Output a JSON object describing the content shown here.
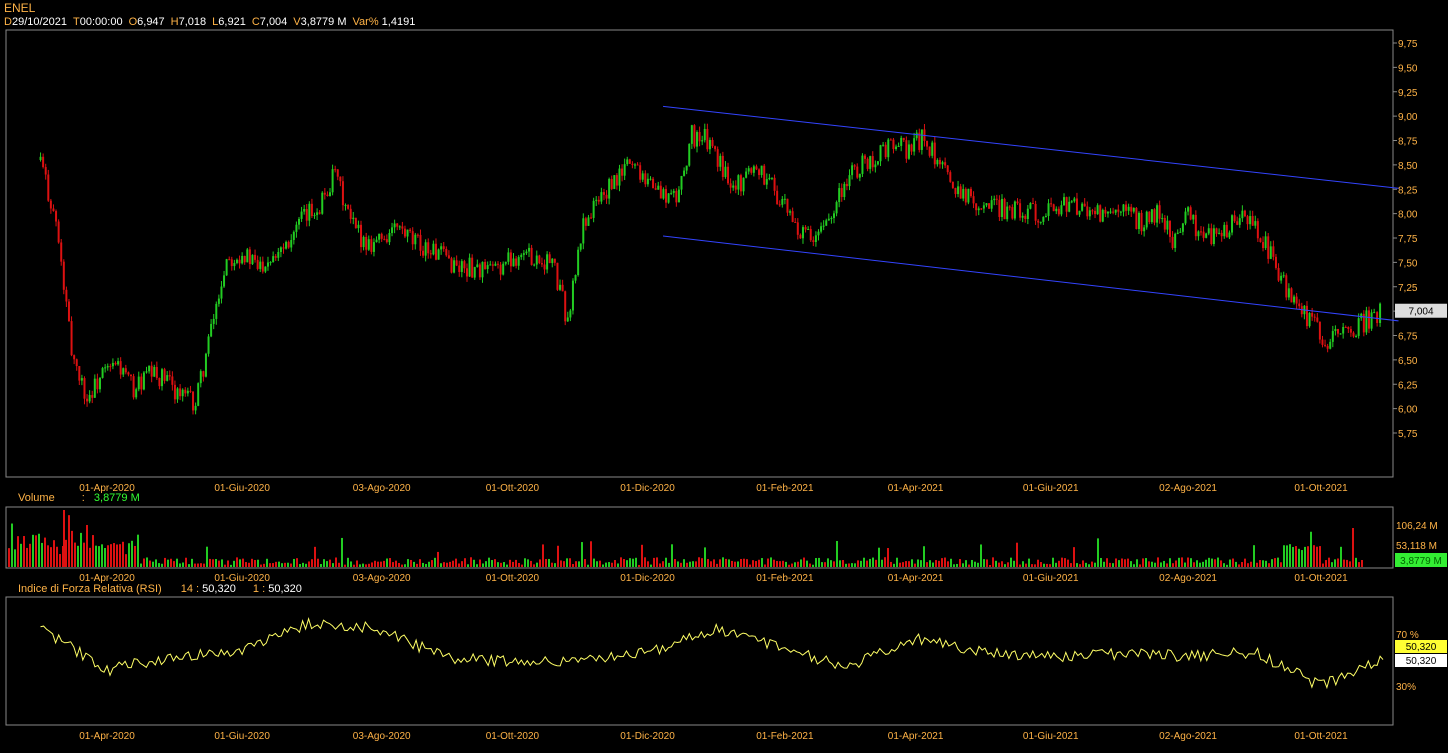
{
  "header": {
    "symbol": "ENEL",
    "fields": [
      {
        "key": "D",
        "value": "29/10/2021"
      },
      {
        "key": "T",
        "value": "00:00:00"
      },
      {
        "key": "O",
        "value": "6,947"
      },
      {
        "key": "H",
        "value": "7,018"
      },
      {
        "key": "L",
        "value": "6,921"
      },
      {
        "key": "C",
        "value": "7,004"
      },
      {
        "key": "V",
        "value": "3,8779 M"
      },
      {
        "key": "Var%",
        "value": "1,4191"
      }
    ]
  },
  "colors": {
    "up": "#22cc22",
    "down": "#dd1111",
    "trend": "#3344ff",
    "rsi": "#ffff66",
    "axis_text": "#ffb347",
    "frame": "#888888"
  },
  "date_labels": [
    "01-Apr-2020",
    "01-Giu-2020",
    "03-Ago-2020",
    "01-Ott-2020",
    "01-Dic-2020",
    "01-Feb-2021",
    "01-Apr-2021",
    "01-Giu-2021",
    "02-Ago-2021",
    "01-Ott-2021"
  ],
  "price_panel": {
    "y_ticks": [
      "9,75",
      "9,50",
      "9,25",
      "9,00",
      "8,75",
      "8,50",
      "8,25",
      "8,00",
      "7,75",
      "7,50",
      "7,25",
      "7,00",
      "6,75",
      "6,50",
      "6,25",
      "6,00",
      "5,75"
    ],
    "last_price_label": "7,004",
    "trend_channel_upper": [
      {
        "date": "2020-12-08",
        "price": 9.1
      },
      {
        "date": "2021-11-05",
        "price": 8.26
      }
    ],
    "trend_channel_lower": [
      {
        "date": "2020-12-08",
        "price": 7.77
      },
      {
        "date": "2021-11-05",
        "price": 6.9
      }
    ]
  },
  "volume_panel": {
    "label": "Volume",
    "sep": ":",
    "current": "3,8779 M",
    "y_ticks": [
      "106,24 M",
      "53,118 M"
    ],
    "last_label": "3,8779 M"
  },
  "rsi_panel": {
    "label": "Indice di Forza Relativa (RSI)",
    "period1": "14",
    "value1": "50,320",
    "period2": "1",
    "value2": "50,320",
    "y_ticks": [
      "70 %",
      "30%"
    ],
    "last_label_a": "50,320",
    "last_label_b": "50,320"
  },
  "chart_data": {
    "type": "line",
    "title": "ENEL",
    "xlabel": "",
    "ylabel": "",
    "x_ticks": [
      "01-Apr-2020",
      "01-Giu-2020",
      "03-Ago-2020",
      "01-Ott-2020",
      "01-Dic-2020",
      "01-Feb-2021",
      "01-Apr-2021",
      "01-Giu-2021",
      "02-Ago-2021",
      "01-Ott-2021"
    ],
    "ylim": [
      5.6,
      9.85
    ],
    "series": [
      {
        "name": "",
        "x": [
          "2020-03-02",
          "2020-03-09",
          "2020-03-16",
          "2020-03-23",
          "2020-03-30",
          "2020-04-06",
          "2020-04-13",
          "2020-04-20",
          "2020-04-27",
          "2020-05-04",
          "2020-05-11",
          "2020-05-18",
          "2020-05-25",
          "2020-06-01",
          "2020-06-08",
          "2020-06-15",
          "2020-06-22",
          "2020-06-29",
          "2020-07-06",
          "2020-07-13",
          "2020-07-20",
          "2020-07-27",
          "2020-08-03",
          "2020-08-10",
          "2020-08-17",
          "2020-08-24",
          "2020-08-31",
          "2020-09-07",
          "2020-09-14",
          "2020-09-21",
          "2020-09-28",
          "2020-10-05",
          "2020-10-12",
          "2020-10-19",
          "2020-10-26",
          "2020-11-02",
          "2020-11-09",
          "2020-11-16",
          "2020-11-23",
          "2020-11-30",
          "2020-12-07",
          "2020-12-14",
          "2020-12-21",
          "2020-12-28",
          "2021-01-04",
          "2021-01-11",
          "2021-01-18",
          "2021-01-25",
          "2021-02-01",
          "2021-02-08",
          "2021-02-15",
          "2021-02-22",
          "2021-03-01",
          "2021-03-08",
          "2021-03-15",
          "2021-03-22",
          "2021-03-29",
          "2021-04-05",
          "2021-04-12",
          "2021-04-19",
          "2021-04-26",
          "2021-05-03",
          "2021-05-10",
          "2021-05-17",
          "2021-05-24",
          "2021-05-31",
          "2021-06-07",
          "2021-06-14",
          "2021-06-21",
          "2021-06-28",
          "2021-07-05",
          "2021-07-12",
          "2021-07-19",
          "2021-07-26",
          "2021-08-02",
          "2021-08-09",
          "2021-08-16",
          "2021-08-23",
          "2021-08-30",
          "2021-09-06",
          "2021-09-13",
          "2021-09-20",
          "2021-09-27",
          "2021-10-04",
          "2021-10-11",
          "2021-10-18",
          "2021-10-25",
          "2021-10-29"
        ],
        "values": [
          8.55,
          7.9,
          6.6,
          6.1,
          6.35,
          6.45,
          6.2,
          6.35,
          6.3,
          6.15,
          6.05,
          6.8,
          7.55,
          7.6,
          7.45,
          7.6,
          7.75,
          7.95,
          8.1,
          8.4,
          7.9,
          7.7,
          7.75,
          7.85,
          7.7,
          7.65,
          7.55,
          7.45,
          7.45,
          7.4,
          7.5,
          7.6,
          7.55,
          7.5,
          6.9,
          7.9,
          8.15,
          8.3,
          8.55,
          8.4,
          8.2,
          8.15,
          8.8,
          8.75,
          8.45,
          8.3,
          8.5,
          8.35,
          8.05,
          7.8,
          7.7,
          8.05,
          8.35,
          8.5,
          8.6,
          8.7,
          8.65,
          8.8,
          8.45,
          8.3,
          8.15,
          8.1,
          8.05,
          8.05,
          8.0,
          8.05,
          8.1,
          8.05,
          8.0,
          7.95,
          8.0,
          7.9,
          8.0,
          7.75,
          8.0,
          7.75,
          7.8,
          7.9,
          7.95,
          7.7,
          7.3,
          7.05,
          6.85,
          6.7,
          6.75,
          6.85,
          6.95,
          7.004
        ]
      }
    ],
    "rsi": {
      "x": [
        "2020-03-02",
        "2020-04-01",
        "2020-05-01",
        "2020-06-01",
        "2020-07-01",
        "2020-08-01",
        "2020-09-01",
        "2020-10-01",
        "2020-11-01",
        "2020-12-01",
        "2021-01-01",
        "2021-02-01",
        "2021-03-01",
        "2021-04-01",
        "2021-05-01",
        "2021-06-01",
        "2021-07-01",
        "2021-08-01",
        "2021-09-01",
        "2021-10-01",
        "2021-10-29"
      ],
      "values": [
        75,
        42,
        53,
        58,
        78,
        74,
        52,
        49,
        50,
        56,
        73,
        58,
        45,
        67,
        57,
        52,
        55,
        53,
        56,
        30,
        50.32
      ]
    },
    "volume": {
      "unit": "M",
      "last": 3.8779,
      "max_tick": 106.24
    }
  }
}
